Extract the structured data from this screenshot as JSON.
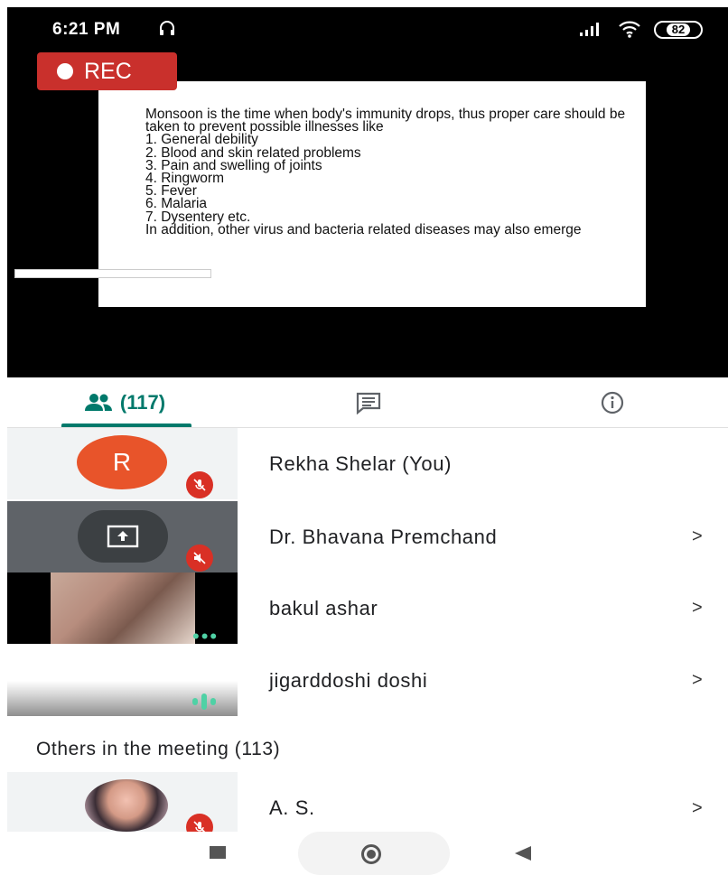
{
  "status_bar": {
    "time": "6:21 PM",
    "battery": "82"
  },
  "recording": {
    "label": "REC"
  },
  "slide": {
    "intro": "Monsoon is the time when body's immunity drops, thus proper care should be taken to prevent possible illnesses like",
    "items": [
      "1.  General debility",
      "2.  Blood and skin related problems",
      "3.  Pain and swelling of joints",
      "4.  Ringworm",
      "5.  Fever",
      "6.  Malaria",
      "7.  Dysentery etc."
    ],
    "footer": "In addition, other virus and bacteria related diseases may also emerge"
  },
  "tabs": {
    "people_count": "(117)",
    "people_icon": "people-icon",
    "chat_icon": "chat-icon",
    "info_icon": "info-icon",
    "accent": "#00796b"
  },
  "participants": [
    {
      "name": "Rekha Shelar (You)",
      "initial": "R",
      "avatar_color": "#e8542a"
    },
    {
      "name": "Dr. Bhavana Premchand",
      "chevron": ">"
    },
    {
      "name": "bakul ashar",
      "chevron": ">"
    },
    {
      "name": "jigarddoshi doshi",
      "chevron": ">"
    }
  ],
  "others": {
    "heading": "Others in the meeting (113)",
    "items": [
      {
        "name": "A. S.",
        "chevron": ">"
      }
    ]
  },
  "colors": {
    "mute_badge": "#d93025",
    "rec": "#c9302c",
    "audio_indicator": "#4fd1a5"
  }
}
